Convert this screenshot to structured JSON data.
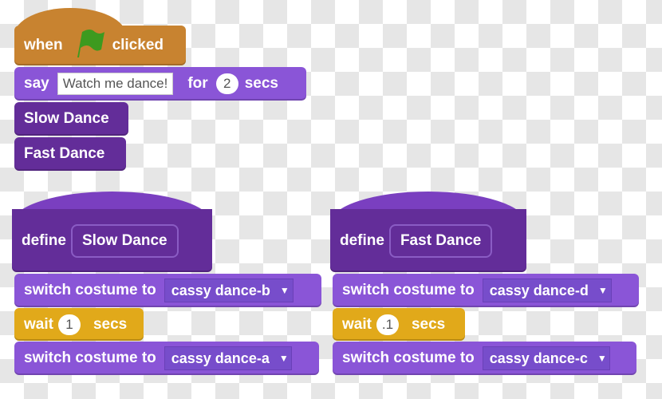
{
  "main_script": {
    "hat": {
      "when": "when",
      "clicked": "clicked",
      "icon": "green-flag-icon"
    },
    "say": {
      "label": "say",
      "text": "Watch me dance!",
      "for": "for",
      "secs_value": "2",
      "secs": "secs"
    },
    "call1": "Slow Dance",
    "call2": "Fast Dance"
  },
  "slow_def": {
    "define": "define",
    "name": "Slow Dance",
    "switch1": {
      "label": "switch costume to",
      "value": "cassy dance-b"
    },
    "wait": {
      "label": "wait",
      "value": "1",
      "secs": "secs"
    },
    "switch2": {
      "label": "switch costume to",
      "value": "cassy dance-a"
    }
  },
  "fast_def": {
    "define": "define",
    "name": "Fast Dance",
    "switch1": {
      "label": "switch costume to",
      "value": "cassy dance-d"
    },
    "wait": {
      "label": "wait",
      "value": ".1",
      "secs": "secs"
    },
    "switch2": {
      "label": "switch costume to",
      "value": "cassy dance-c"
    }
  },
  "colors": {
    "events": "#c88330",
    "looks": "#8a55d7",
    "custom": "#632d99",
    "control": "#e1a91a",
    "flag": "#3d9a1f"
  }
}
